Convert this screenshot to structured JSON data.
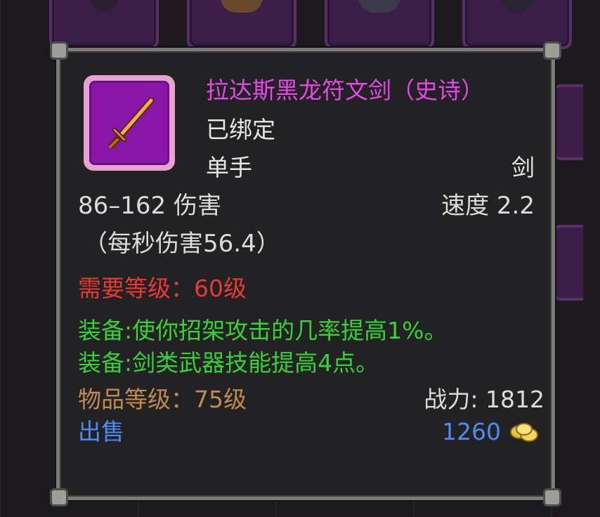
{
  "item": {
    "name": "拉达斯黑龙符文剑（史诗）",
    "bind_status": "已绑定",
    "slot": "单手",
    "weapon_type": "剑",
    "damage": "86–162 伤害",
    "speed": "速度 2.2",
    "dps": "（每秒伤害56.4）",
    "requirement": "需要等级：60级",
    "equip_effects": [
      "装备:使你招架攻击的几率提高1%。",
      "装备:剑类武器技能提高4点。"
    ],
    "item_level": "物品等级：75级",
    "power": "战力: 1812",
    "sell_label": "出售",
    "sell_price": "1260",
    "icon": "sword-icon",
    "price_icon": "gold-coins-icon"
  },
  "colors": {
    "epic": "#e24ae6",
    "requirement": "#e73a35",
    "equip": "#36d236",
    "item_level": "#c08a50",
    "sell": "#4b8cf0"
  }
}
